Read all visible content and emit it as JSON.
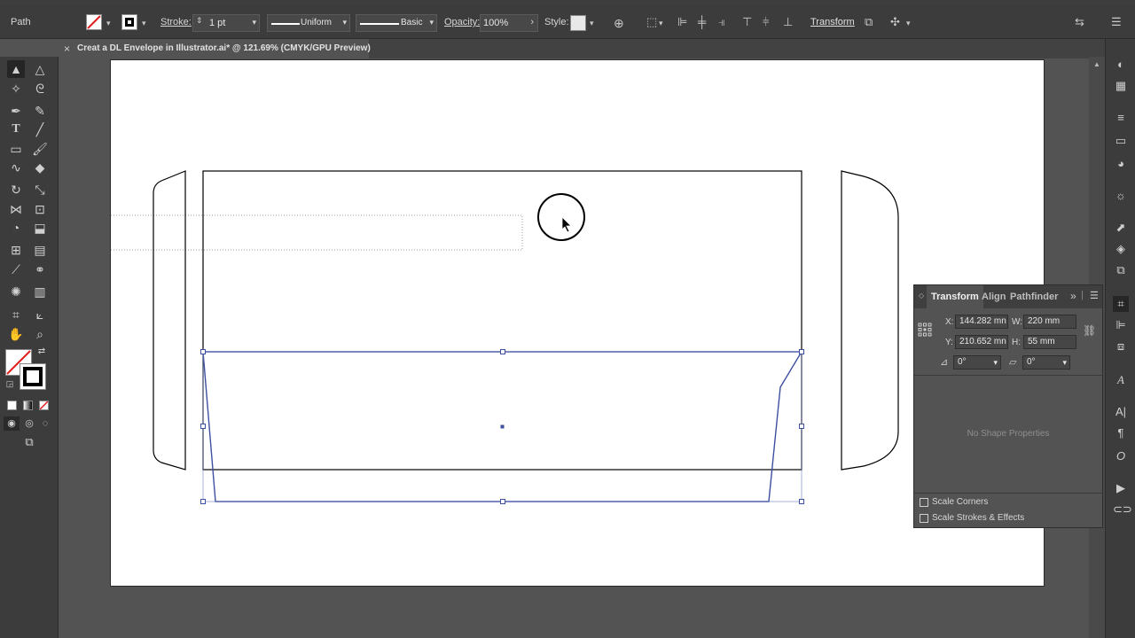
{
  "control_bar": {
    "selection_type": "Path",
    "stroke_label": "Stroke:",
    "stroke_weight": "1 pt",
    "variable_width": "Uniform",
    "brush": "Basic",
    "opacity_label": "Opacity:",
    "opacity_value": "100%",
    "style_label": "Style:",
    "transform_link": "Transform"
  },
  "document_tab": {
    "close": "×",
    "title": "Creat a DL Envelope in Illustrator.ai* @ 121.69% (CMYK/GPU Preview)"
  },
  "transform_panel": {
    "tabs": [
      "Transform",
      "Align",
      "Pathfinder"
    ],
    "x_label": "X:",
    "x_value": "144.282 mn",
    "y_label": "Y:",
    "y_value": "210.652 mn",
    "w_label": "W:",
    "w_value": "220 mm",
    "h_label": "H:",
    "h_value": "55 mm",
    "rotate_value": "0°",
    "shear_value": "0°",
    "no_shape": "No Shape Properties",
    "scale_corners": "Scale Corners",
    "scale_strokes": "Scale Strokes & Effects"
  },
  "colors": {
    "selection": "#3d4fa0",
    "artwork_stroke": "#000000",
    "ui_dark": "#3c3c3c",
    "canvas_bg": "#535353"
  }
}
